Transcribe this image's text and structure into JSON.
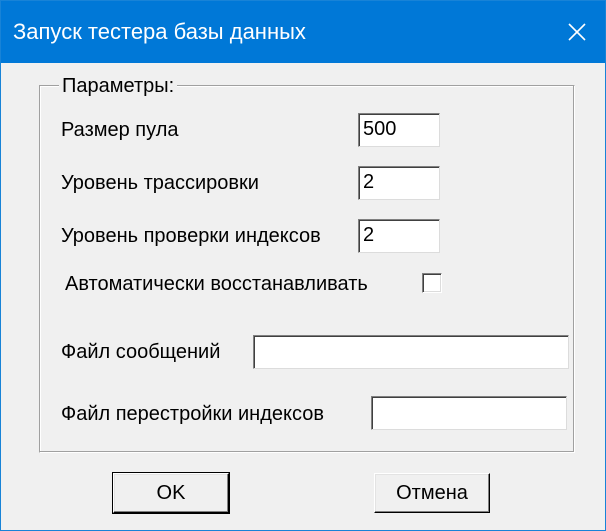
{
  "window": {
    "title": "Запуск тестера базы данных",
    "close_icon": "close-icon",
    "accent_color": "#0078d7"
  },
  "group": {
    "label": "Параметры:"
  },
  "fields": {
    "pool_size": {
      "label": "Размер пула",
      "value": "500"
    },
    "trace_level": {
      "label": "Уровень трассировки",
      "value": "2"
    },
    "index_check_level": {
      "label": "Уровень проверки индексов",
      "value": "2"
    },
    "auto_restore": {
      "label": "Автоматически восстанавливать",
      "checked": false
    },
    "message_file": {
      "label": "Файл сообщений",
      "value": ""
    },
    "index_rebuild_file": {
      "label": "Файл перестройки индексов",
      "value": ""
    }
  },
  "buttons": {
    "ok_label": "OK",
    "cancel_label": "Отмена"
  }
}
